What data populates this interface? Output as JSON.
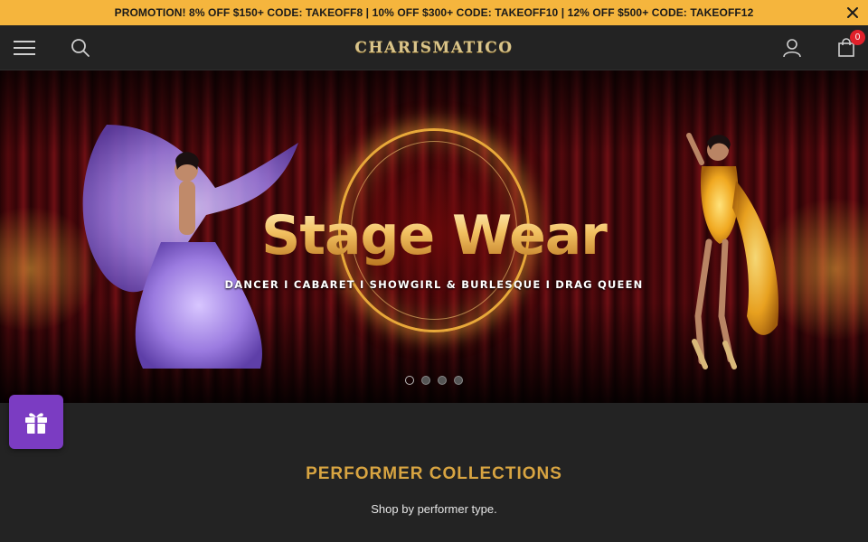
{
  "promo": {
    "text": "PROMOTION! 8% OFF $150+ CODE: TAKEOFF8 | 10% OFF $300+ CODE: TAKEOFF10 | 12% OFF $500+ CODE: TAKEOFF12",
    "close_icon": "close-icon"
  },
  "header": {
    "logo": "CHARISMATICO",
    "menu_icon": "hamburger-menu-icon",
    "search_icon": "search-icon",
    "account_icon": "user-icon",
    "cart_icon": "shopping-bag-icon",
    "cart_count": "0"
  },
  "hero": {
    "title": "Stage Wear",
    "subtitle": "DANCER  I CABARET  I SHOWGIRL & BURLESQUE I DRAG QUEEN",
    "slides_total": 4,
    "active_slide": 1
  },
  "gift_button": {
    "icon": "gift-icon"
  },
  "section": {
    "title": "PERFORMER COLLECTIONS",
    "subtitle": "Shop by performer type."
  },
  "colors": {
    "promo_bar": "#f5b53d",
    "header_bg": "#232323",
    "accent_gold": "#d8a441",
    "gift_purple": "#7b3cc2",
    "badge_red": "#e0202a"
  }
}
